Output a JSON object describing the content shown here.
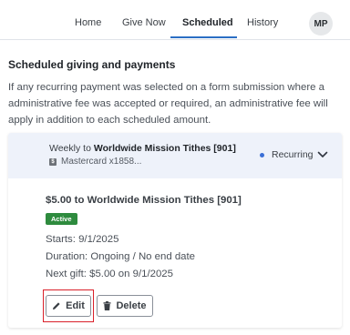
{
  "nav": {
    "tabs": [
      {
        "label": "Home"
      },
      {
        "label": "Give Now"
      },
      {
        "label": "Scheduled",
        "active": true
      },
      {
        "label": "History"
      }
    ],
    "avatar_initials": "MP",
    "accent_color": "#2b6fc4"
  },
  "page": {
    "heading": "Scheduled giving and payments",
    "description": "If any recurring payment was selected on a form submission where a administrative fee was accepted or required, an administrative fee will apply in addition to each scheduled amount."
  },
  "schedule": {
    "frequency_prefix": "Weekly to",
    "fund": "Worldwide Mission Tithes [901]",
    "payment_method": "Mastercard x1858...",
    "payment_icon": "card-icon",
    "status_label": "Recurring",
    "status_dot_color": "#3b6fd6",
    "amount_title": "$5.00 to Worldwide Mission Tithes [901]",
    "badge": "Active",
    "badge_color": "#2e8b3e",
    "starts": "Starts: 9/1/2025",
    "duration": "Duration: Ongoing / No end date",
    "next_gift": "Next gift: $5.00 on 9/1/2025",
    "edit_label": "Edit",
    "delete_label": "Delete",
    "highlight_color": "#d9202a"
  }
}
